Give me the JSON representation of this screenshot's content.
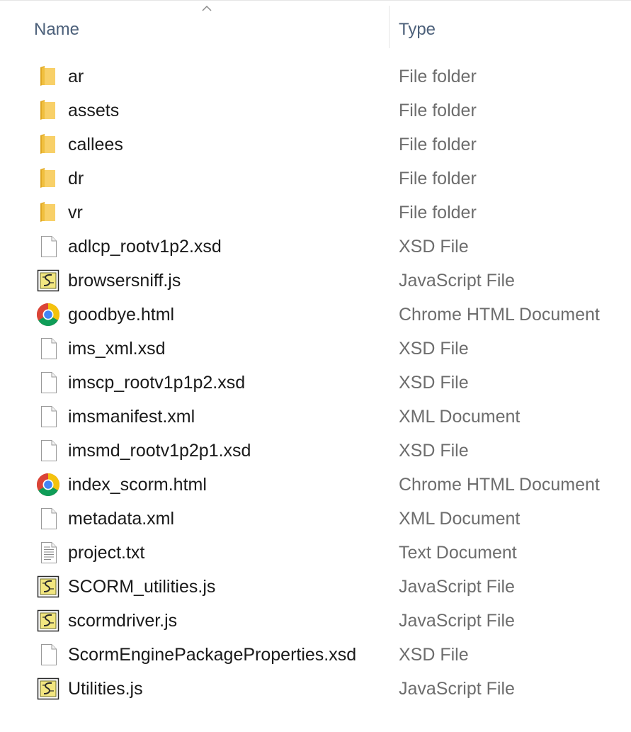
{
  "columns": {
    "name": "Name",
    "type": "Type"
  },
  "sort": {
    "column": "name",
    "direction": "ascending",
    "icon": "chevron-up-icon"
  },
  "colors": {
    "header_text": "#4c607a",
    "name_text": "#1a1a1a",
    "type_text": "#6d6d6d",
    "folder": "#f5c542",
    "js_icon": "#e8d44d"
  },
  "files": [
    {
      "name": "ar",
      "type": "File folder",
      "icon": "folder"
    },
    {
      "name": "assets",
      "type": "File folder",
      "icon": "folder"
    },
    {
      "name": "callees",
      "type": "File folder",
      "icon": "folder"
    },
    {
      "name": "dr",
      "type": "File folder",
      "icon": "folder"
    },
    {
      "name": "vr",
      "type": "File folder",
      "icon": "folder"
    },
    {
      "name": "adlcp_rootv1p2.xsd",
      "type": "XSD File",
      "icon": "blank-file"
    },
    {
      "name": "browsersniff.js",
      "type": "JavaScript File",
      "icon": "script"
    },
    {
      "name": "goodbye.html",
      "type": "Chrome HTML Document",
      "icon": "chrome"
    },
    {
      "name": "ims_xml.xsd",
      "type": "XSD File",
      "icon": "blank-file"
    },
    {
      "name": "imscp_rootv1p1p2.xsd",
      "type": "XSD File",
      "icon": "blank-file"
    },
    {
      "name": "imsmanifest.xml",
      "type": "XML Document",
      "icon": "blank-file"
    },
    {
      "name": "imsmd_rootv1p2p1.xsd",
      "type": "XSD File",
      "icon": "blank-file"
    },
    {
      "name": "index_scorm.html",
      "type": "Chrome HTML Document",
      "icon": "chrome"
    },
    {
      "name": "metadata.xml",
      "type": "XML Document",
      "icon": "blank-file"
    },
    {
      "name": "project.txt",
      "type": "Text Document",
      "icon": "text-file"
    },
    {
      "name": "SCORM_utilities.js",
      "type": "JavaScript File",
      "icon": "script"
    },
    {
      "name": "scormdriver.js",
      "type": "JavaScript File",
      "icon": "script"
    },
    {
      "name": "ScormEnginePackageProperties.xsd",
      "type": "XSD File",
      "icon": "blank-file"
    },
    {
      "name": "Utilities.js",
      "type": "JavaScript File",
      "icon": "script"
    }
  ]
}
